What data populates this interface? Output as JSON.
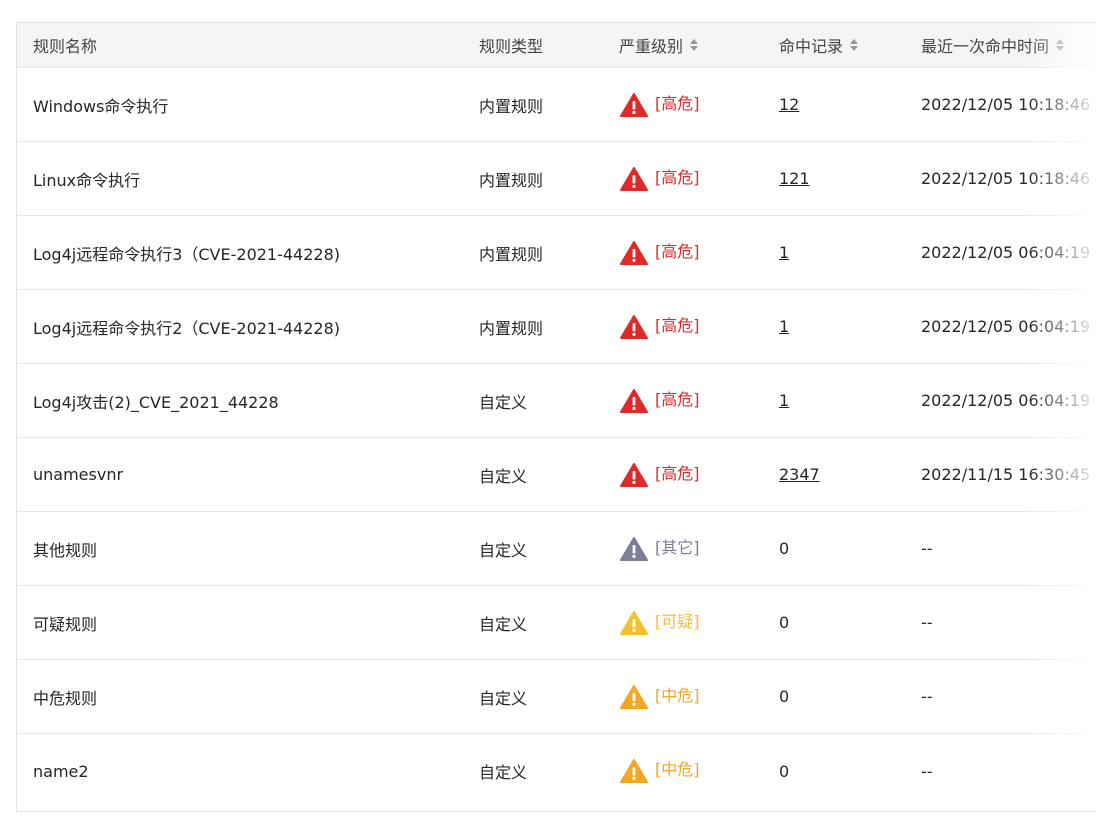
{
  "colors": {
    "high": "#e02a2a",
    "other": "#7c7f97",
    "suspicious": "#f6c02c",
    "medium": "#f5a623"
  },
  "table": {
    "headers": {
      "name": "规则名称",
      "type": "规则类型",
      "severity": "严重级别",
      "hits": "命中记录",
      "last_hit": "最近一次命中时间"
    },
    "rows": [
      {
        "name": "Windows命令执行",
        "type": "内置规则",
        "severity": "[高危]",
        "severity_level": "high",
        "hits": "12",
        "hits_link": true,
        "last_hit": "2022/12/05 10:18:46"
      },
      {
        "name": "Linux命令执行",
        "type": "内置规则",
        "severity": "[高危]",
        "severity_level": "high",
        "hits": "121",
        "hits_link": true,
        "last_hit": "2022/12/05 10:18:46"
      },
      {
        "name": "Log4j远程命令执行3（CVE-2021-44228)",
        "type": "内置规则",
        "severity": "[高危]",
        "severity_level": "high",
        "hits": "1",
        "hits_link": true,
        "last_hit": "2022/12/05 06:04:19"
      },
      {
        "name": "Log4j远程命令执行2（CVE-2021-44228)",
        "type": "内置规则",
        "severity": "[高危]",
        "severity_level": "high",
        "hits": "1",
        "hits_link": true,
        "last_hit": "2022/12/05 06:04:19"
      },
      {
        "name": "Log4j攻击(2)_CVE_2021_44228",
        "type": "自定义",
        "severity": "[高危]",
        "severity_level": "high",
        "hits": "1",
        "hits_link": true,
        "last_hit": "2022/12/05 06:04:19"
      },
      {
        "name": "unamesvnr",
        "type": "自定义",
        "severity": "[高危]",
        "severity_level": "high",
        "hits": "2347",
        "hits_link": true,
        "last_hit": "2022/11/15 16:30:45"
      },
      {
        "name": "其他规则",
        "type": "自定义",
        "severity": "[其它]",
        "severity_level": "other",
        "hits": "0",
        "hits_link": false,
        "last_hit": "--"
      },
      {
        "name": "可疑规则",
        "type": "自定义",
        "severity": "[可疑]",
        "severity_level": "suspicious",
        "hits": "0",
        "hits_link": false,
        "last_hit": "--"
      },
      {
        "name": "中危规则",
        "type": "自定义",
        "severity": "[中危]",
        "severity_level": "medium",
        "hits": "0",
        "hits_link": false,
        "last_hit": "--"
      },
      {
        "name": "name2",
        "type": "自定义",
        "severity": "[中危]",
        "severity_level": "medium",
        "hits": "0",
        "hits_link": false,
        "last_hit": "--"
      }
    ]
  }
}
